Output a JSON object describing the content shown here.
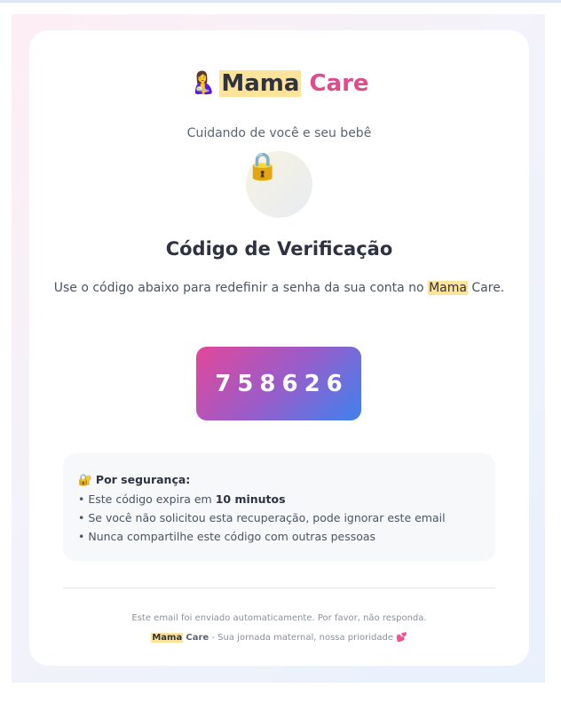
{
  "brand": {
    "emoji": "🤱",
    "mama": "Mama",
    "care": "Care",
    "tagline": "Cuidando de você e seu bebê"
  },
  "hero": {
    "lock_emoji": "🔒",
    "title": "Código de Verificação",
    "intro_before": "Use o código abaixo para redefinir a senha da sua conta no ",
    "intro_mama": "Mama",
    "intro_after": " Care."
  },
  "code": {
    "value": "758626"
  },
  "security": {
    "title": "🔐 Por segurança:",
    "line1_before": "• Este código expira em ",
    "line1_bold": "10 minutos",
    "line2": "• Se você não solicitou esta recuperação, pode ignorar este email",
    "line3": "• Nunca compartilhe este código com outras pessoas"
  },
  "footer": {
    "notice": "Este email foi enviado automaticamente. Por favor, não responda.",
    "mama": "Mama",
    "care": "Care",
    "slogan": " - Sua jornada maternal, nossa prioridade 💕"
  },
  "colors": {
    "accent_pink": "#e04b8d",
    "highlight": "#fde49a",
    "code_gradient_start": "#e3479a",
    "code_gradient_end": "#3f82ee"
  }
}
